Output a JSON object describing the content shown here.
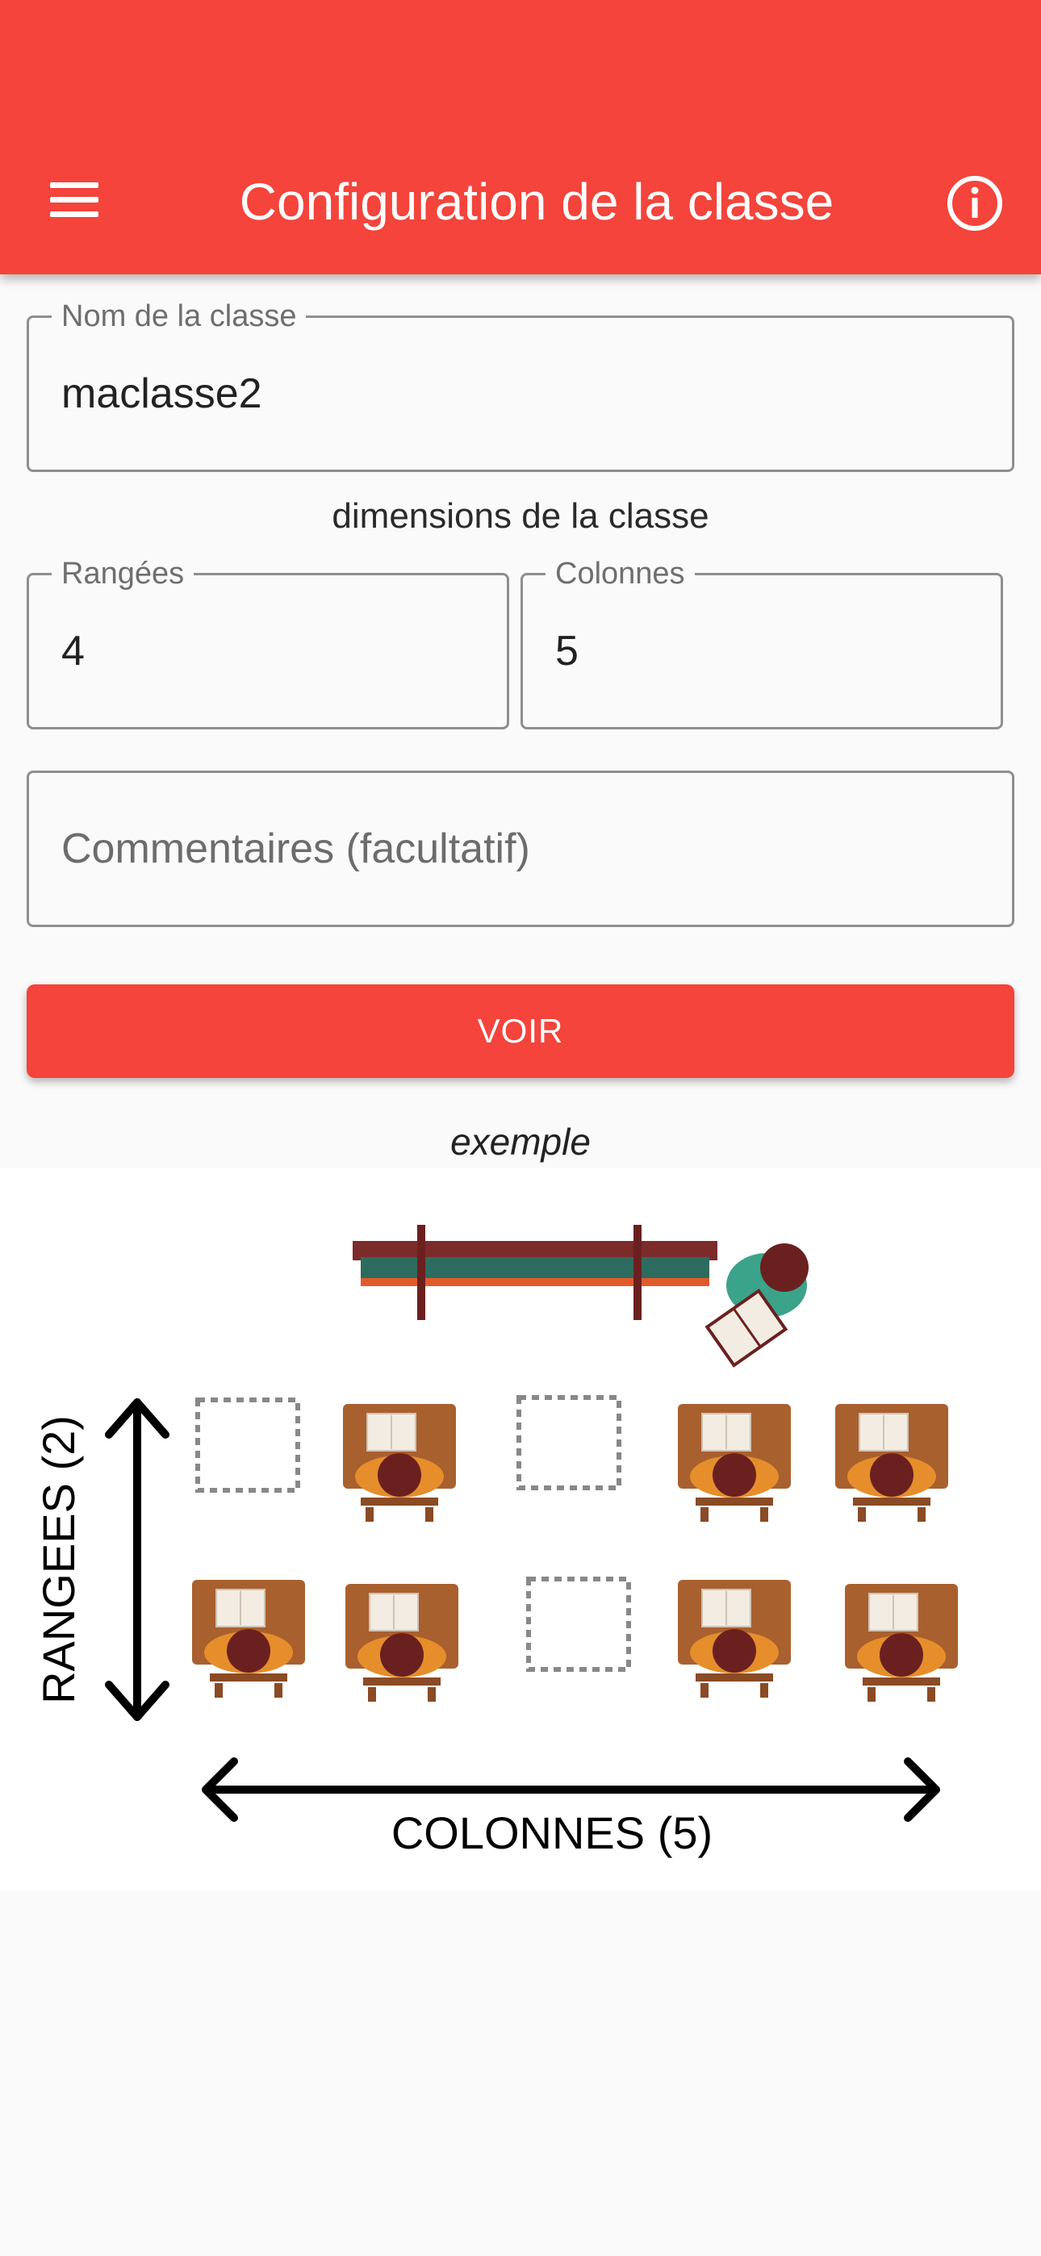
{
  "app_bar": {
    "title": "Configuration de la classe",
    "menu_icon": "hamburger-menu-icon",
    "info_icon": "info-circle-icon",
    "background": "#f4443b"
  },
  "form": {
    "class_name": {
      "label": "Nom de la classe",
      "value": "maclasse2"
    },
    "dimensions_label": "dimensions de la classe",
    "rows": {
      "label": "Rangées",
      "value": "4"
    },
    "columns": {
      "label": "Colonnes",
      "value": "5"
    },
    "comments": {
      "placeholder": "Commentaires (facultatif)"
    },
    "submit_label": "VOIR"
  },
  "example": {
    "caption": "exemple",
    "illustration": {
      "y_axis_label": "RANGEES  (2)",
      "x_axis_label": "COLONNES (5)"
    }
  }
}
